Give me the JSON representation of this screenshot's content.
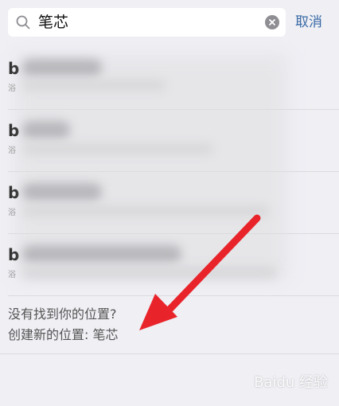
{
  "search": {
    "query": "笔芯",
    "cancel_label": "取消"
  },
  "results": [
    {
      "initial": "b",
      "sub": "浴"
    },
    {
      "initial": "b",
      "sub": "浴"
    },
    {
      "initial": "b",
      "sub": "浴"
    },
    {
      "initial": "b",
      "sub": "浴"
    }
  ],
  "footer": {
    "not_found": "没有找到你的位置?",
    "create_new": "创建新的位置: 笔芯"
  },
  "annotation": {
    "arrow_color": "#e8242a"
  },
  "watermark": {
    "text": "Baidu 经验"
  },
  "colors": {
    "accent": "#3a6aa6",
    "background": "#efeff4"
  }
}
